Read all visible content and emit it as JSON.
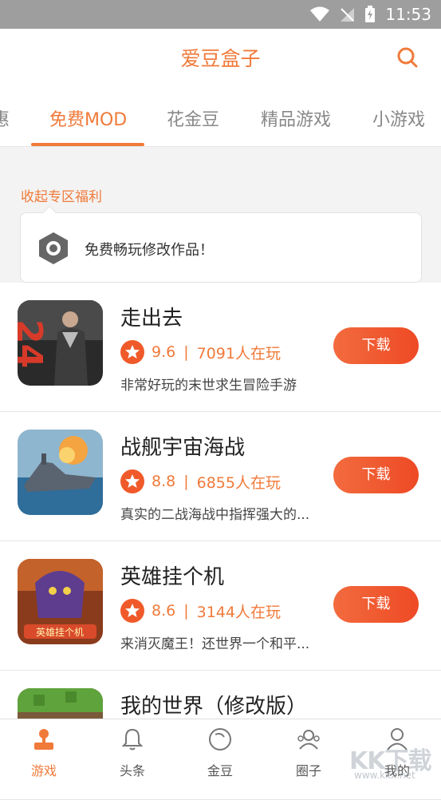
{
  "status_bar": {
    "time": "11:53"
  },
  "app": {
    "title": "爱豆盒子"
  },
  "tabs": [
    {
      "label": "惠"
    },
    {
      "label": "免费MOD"
    },
    {
      "label": "花金豆"
    },
    {
      "label": "精品游戏"
    },
    {
      "label": "小游戏"
    }
  ],
  "promo": {
    "label": "收起专区福利",
    "text": "免费畅玩修改作品！"
  },
  "games": [
    {
      "name": "走出去",
      "rating": "9.6",
      "players": "7091人在玩",
      "desc": "非常好玩的末世求生冒险手游",
      "button": "下载"
    },
    {
      "name": "战舰宇宙海战",
      "rating": "8.8",
      "players": "6855人在玩",
      "desc": "真实的二战海战中指挥强大的...",
      "button": "下载"
    },
    {
      "name": "英雄挂个机",
      "rating": "8.6",
      "players": "3144人在玩",
      "desc": "来消灭魔王！还世界一个和平...",
      "button": "下载"
    },
    {
      "name": "我的世界（修改版）"
    }
  ],
  "bottom_nav": [
    {
      "label": "游戏"
    },
    {
      "label": "头条"
    },
    {
      "label": "金豆"
    },
    {
      "label": "圈子"
    },
    {
      "label": "我的"
    }
  ],
  "watermark": {
    "text": "KK下载",
    "url": "www.kkx.net"
  },
  "colors": {
    "accent": "#f07a3a",
    "button": "#ee4a25"
  }
}
